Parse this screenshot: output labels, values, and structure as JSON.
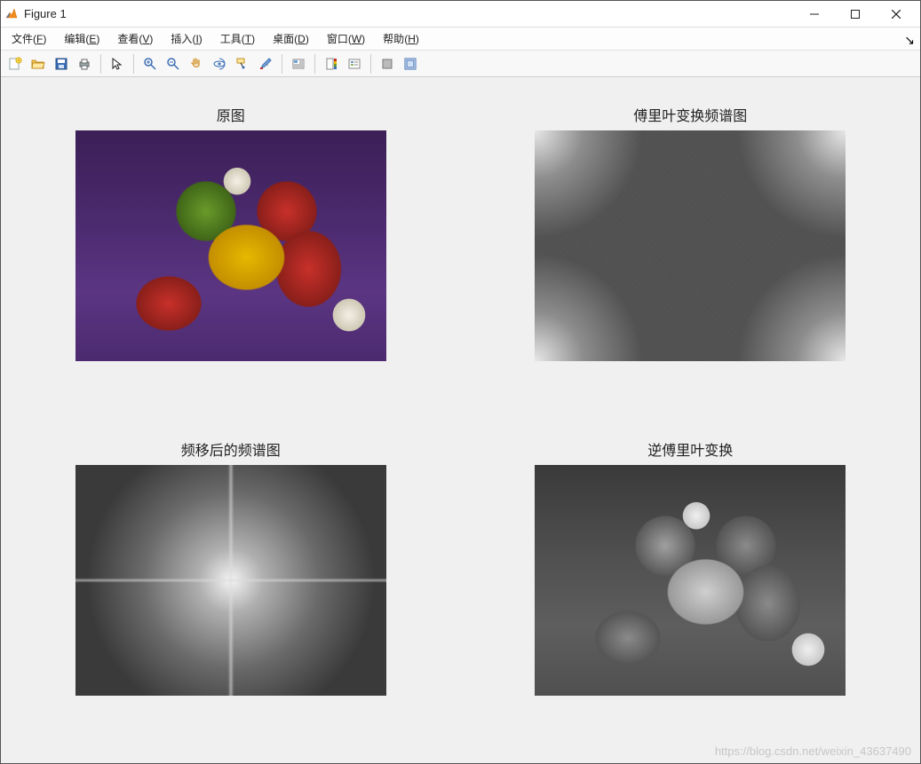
{
  "window": {
    "title": "Figure 1"
  },
  "menus": {
    "file": {
      "label": "文件",
      "accel": "F"
    },
    "edit": {
      "label": "编辑",
      "accel": "E"
    },
    "view": {
      "label": "查看",
      "accel": "V"
    },
    "insert": {
      "label": "插入",
      "accel": "I"
    },
    "tools": {
      "label": "工具",
      "accel": "T"
    },
    "desktop": {
      "label": "桌面",
      "accel": "D"
    },
    "window": {
      "label": "窗口",
      "accel": "W"
    },
    "help": {
      "label": "帮助",
      "accel": "H"
    }
  },
  "toolbar": {
    "new": "new-figure-icon",
    "open": "open-icon",
    "save": "save-icon",
    "print": "print-icon",
    "pointer": "pointer-icon",
    "zoom_in": "zoom-in-icon",
    "zoom_out": "zoom-out-icon",
    "pan": "pan-icon",
    "rotate3d": "rotate-3d-icon",
    "datacursor": "data-cursor-icon",
    "brush": "brush-icon",
    "link": "link-icon",
    "colorbar": "colorbar-icon",
    "legend": "legend-icon",
    "hide": "hide-plot-tools-icon",
    "show": "show-plot-tools-icon"
  },
  "subplots": {
    "top_left": {
      "title": "原图"
    },
    "top_right": {
      "title": "傅里叶变换频谱图"
    },
    "bottom_left": {
      "title": "频移后的频谱图"
    },
    "bottom_right": {
      "title": "逆傅里叶变换"
    }
  },
  "watermark": "https://blog.csdn.net/weixin_43637490"
}
